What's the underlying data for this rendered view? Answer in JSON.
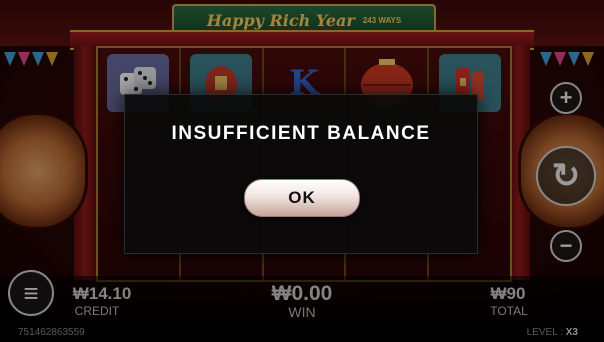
{
  "game": {
    "title": "Happy Rich Year",
    "ways": "243 WAYS"
  },
  "reels": [
    {
      "top_symbol": "dice-icon",
      "accent": "#b9b4c8"
    },
    {
      "top_symbol": "fu-lantern-icon",
      "accent": "#c73a2a"
    },
    {
      "top_symbol": "K",
      "accent": "#3a6ad4"
    },
    {
      "top_symbol": "red-lantern-icon",
      "accent": "#d23a22"
    },
    {
      "top_symbol": "firecracker-icon",
      "accent": "#d8342a"
    }
  ],
  "side_buttons": {
    "plus": "+",
    "spin": "↻",
    "minus": "−",
    "menu": "≡"
  },
  "bottom_bar": {
    "credit_value": "₩14.10",
    "credit_label": "CREDIT",
    "win_value": "₩0.00",
    "win_label": "WIN",
    "total_value": "₩90",
    "total_label": "TOTAL"
  },
  "footer": {
    "session_id": "751462863559",
    "level_label": "LEVEL :",
    "level_value": "X3"
  },
  "modal": {
    "message": "INSUFFICIENT BALANCE",
    "ok_label": "OK"
  },
  "colors": {
    "accent_red": "#8f1919",
    "gold": "#caa34a",
    "modal_bg": "#0a0a0a"
  }
}
